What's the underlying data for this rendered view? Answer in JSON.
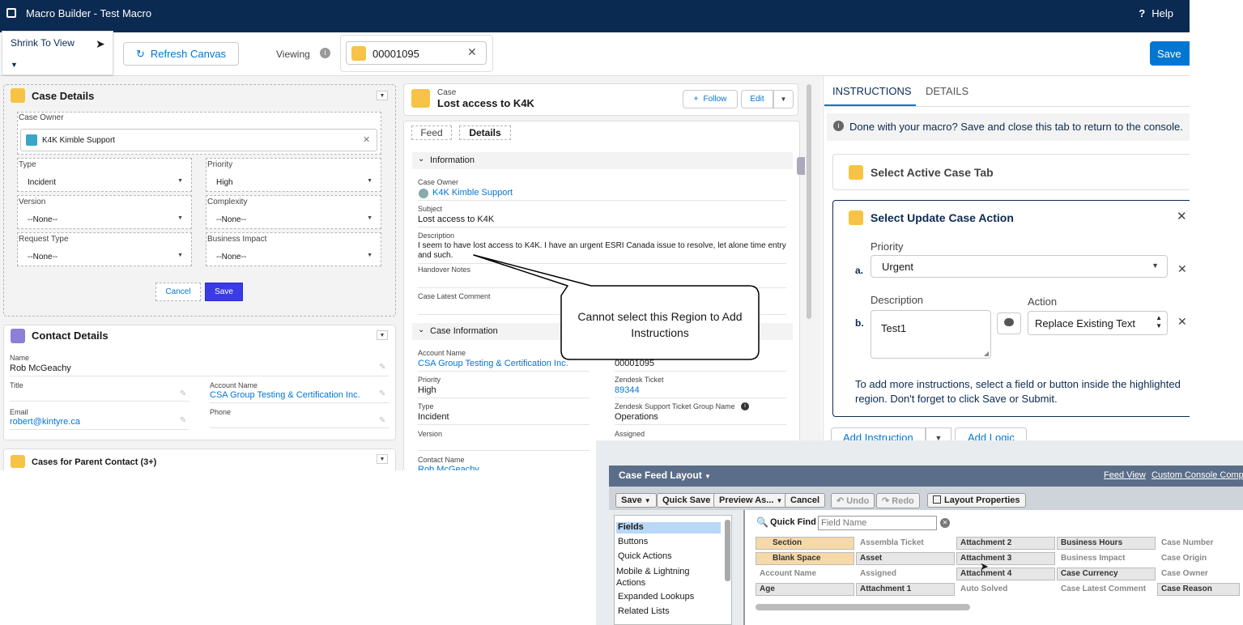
{
  "topbar": {
    "title": "Macro Builder - Test Macro",
    "help": "Help"
  },
  "toolbar": {
    "shrink": "Shrink To View",
    "refresh": "Refresh Canvas",
    "viewing": "Viewing",
    "record": "00001095",
    "save": "Save"
  },
  "case_details": {
    "title": "Case Details",
    "case_owner_label": "Case Owner",
    "case_owner": "K4K Kimble Support",
    "type_label": "Type",
    "type": "Incident",
    "priority_label": "Priority",
    "priority": "High",
    "version_label": "Version",
    "version": "--None--",
    "complexity_label": "Complexity",
    "complexity": "--None--",
    "request_type_label": "Request Type",
    "request_type": "--None--",
    "business_impact_label": "Business Impact",
    "business_impact": "--None--",
    "cancel": "Cancel",
    "save": "Save"
  },
  "contact_details": {
    "title": "Contact Details",
    "name_label": "Name",
    "name": "Rob McGeachy",
    "title_label": "Title",
    "account_label": "Account Name",
    "account": "CSA Group Testing & Certification Inc.",
    "email_label": "Email",
    "email": "robert@kintyre.ca",
    "phone_label": "Phone"
  },
  "cases_parent": {
    "title": "Cases for Parent Contact (3+)"
  },
  "case_record": {
    "object": "Case",
    "title": "Lost access to K4K",
    "follow": "Follow",
    "edit": "Edit",
    "tab_feed": "Feed",
    "tab_details": "Details",
    "section_info": "Information",
    "owner_label": "Case Owner",
    "owner": "K4K Kimble Support",
    "subject_label": "Subject",
    "subject": "Lost access to K4K",
    "description_label": "Description",
    "description": "I seem to have lost access to K4K. I have an urgent ESRI Canada issue to resolve, let alone time entry and such.",
    "handover_label": "Handover Notes",
    "latest_comment_label": "Case Latest Comment",
    "section_case_info": "Case Information",
    "account_label": "Account Name",
    "account": "CSA Group Testing & Certification Inc.",
    "case_number": "00001095",
    "priority_label": "Priority",
    "priority": "High",
    "zendesk_label": "Zendesk Ticket",
    "zendesk": "89344",
    "type_label": "Type",
    "type": "Incident",
    "group_label": "Zendesk Support Ticket Group Name",
    "group": "Operations",
    "version_label": "Version",
    "assigned_label": "Assigned",
    "contact_label": "Contact Name",
    "contact": "Rob McGeachy"
  },
  "callout": "Cannot select this Region to Add Instructions",
  "instructions": {
    "tab_instructions": "INSTRUCTIONS",
    "tab_details": "DETAILS",
    "notice": "Done with your macro? Save and close this tab to return to the console.",
    "step1": "Select Active Case Tab",
    "step2": "Select Update Case Action",
    "priority_label": "Priority",
    "priority": "Urgent",
    "a": "a.",
    "description_label": "Description",
    "description": "Test1",
    "b": "b.",
    "action_label": "Action",
    "action": "Replace Existing Text",
    "help_text": "To add more instructions, select a field or button inside the highlighted region. Don't forget to click Save or Submit.",
    "add_instruction": "Add Instruction",
    "add_logic": "Add Logic"
  },
  "layout_editor": {
    "title": "Case Feed Layout",
    "feed_view": "Feed View",
    "custom_console": "Custom Console Comp",
    "buttons": [
      "Save",
      "Quick Save",
      "Preview As...",
      "Cancel",
      "Undo",
      "Redo",
      "Layout Properties"
    ],
    "categories": [
      "Fields",
      "Buttons",
      "Quick Actions",
      "Mobile & Lightning Actions",
      "Expanded Lookups",
      "Related Lists"
    ],
    "quick_find": "Quick Find",
    "field_placeholder": "Field Name",
    "fields": [
      [
        "Section",
        "Assembla Ticket",
        "Attachment 2",
        "Business Hours",
        "Case Number"
      ],
      [
        "Blank Space",
        "Asset",
        "Attachment 3",
        "Business Impact",
        "Case Origin"
      ],
      [
        "Account Name",
        "Assigned",
        "Attachment 4",
        "Case Currency",
        "Case Owner"
      ],
      [
        "Age",
        "Attachment 1",
        "Auto Solved",
        "Case Latest Comment",
        "Case Reason"
      ]
    ]
  }
}
